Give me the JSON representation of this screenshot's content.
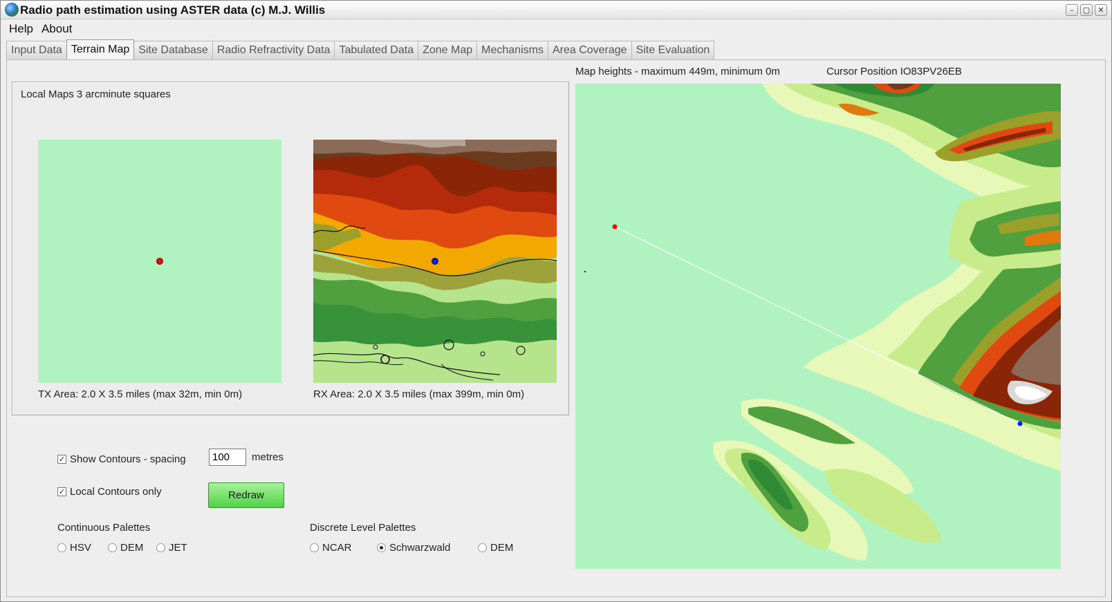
{
  "window": {
    "title": "Radio path estimation using ASTER data (c) M.J. Willis",
    "controls": [
      "–",
      "▢",
      "✕"
    ]
  },
  "menu": {
    "help": "Help",
    "about": "About"
  },
  "tabs": [
    {
      "label": "Input Data",
      "active": false
    },
    {
      "label": "Terrain Map",
      "active": true
    },
    {
      "label": "Site Database",
      "active": false
    },
    {
      "label": "Radio Refractivity Data",
      "active": false
    },
    {
      "label": "Tabulated Data",
      "active": false
    },
    {
      "label": "Zone Map",
      "active": false
    },
    {
      "label": "Mechanisms",
      "active": false
    },
    {
      "label": "Area Coverage",
      "active": false
    },
    {
      "label": "Site Evaluation",
      "active": false
    }
  ],
  "local_maps": {
    "title": "Local Maps 3 arcminute squares",
    "tx_label": "TX Area: 2.0 X 3.5 miles  (max 32m,  min 0m)",
    "rx_label": "RX Area: 2.0 X 3.5 miles  (max 399m,  min 0m)"
  },
  "controls": {
    "show_contours_label": "Show Contours - spacing",
    "show_contours_checked": true,
    "spacing_value": "100",
    "spacing_unit": "metres",
    "local_contours_label": "Local Contours only",
    "local_contours_checked": true,
    "redraw_label": "Redraw"
  },
  "palettes": {
    "continuous_label": "Continuous Palettes",
    "continuous_options": [
      {
        "label": "HSV",
        "selected": false
      },
      {
        "label": "DEM",
        "selected": false
      },
      {
        "label": "JET",
        "selected": false
      }
    ],
    "discrete_label": "Discrete Level Palettes",
    "discrete_options": [
      {
        "label": "NCAR",
        "selected": false
      },
      {
        "label": "Schwarzwald",
        "selected": true
      },
      {
        "label": "DEM",
        "selected": false
      }
    ]
  },
  "map_header": {
    "heights": "Map heights - maximum 449m,  minimum 0m",
    "cursor": "Cursor Position IO83PV26EB"
  },
  "colors": {
    "sea": "#b0f2c0",
    "tx_marker": "#e01010",
    "rx_marker": "#1020e0",
    "path_line": "#ffffff"
  }
}
